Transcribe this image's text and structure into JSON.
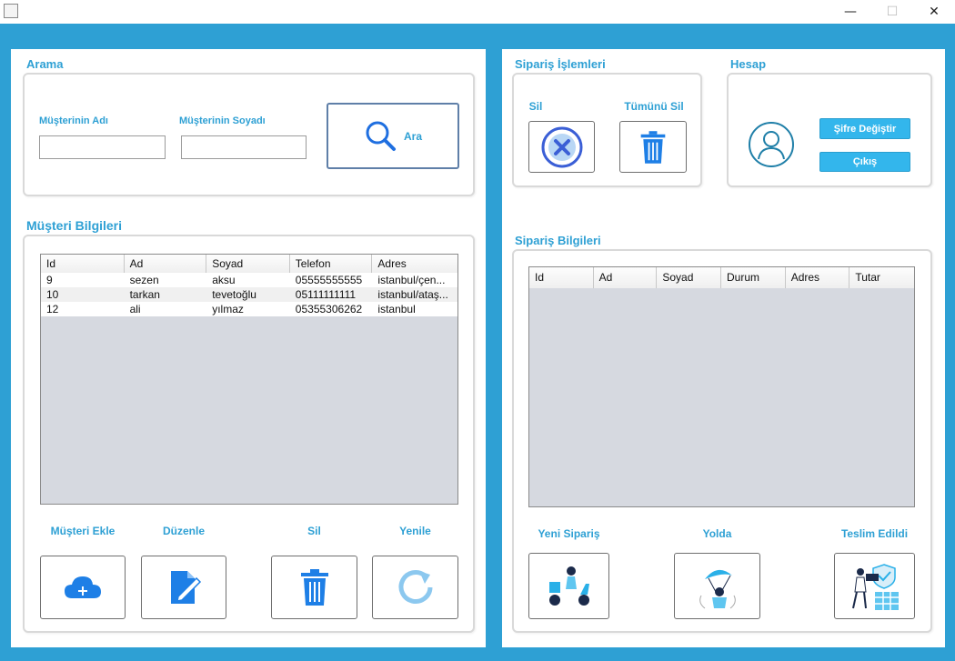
{
  "window": {
    "minimize": "—",
    "maximize": "☐",
    "close": "✕"
  },
  "search": {
    "title": "Arama",
    "first_name_label": "Müşterinin Adı",
    "first_name_value": "",
    "last_name_label": "Müşterinin Soyadı",
    "last_name_value": "",
    "search_button": "Ara"
  },
  "customers": {
    "title": "Müşteri Bilgileri",
    "columns": [
      "Id",
      "Ad",
      "Soyad",
      "Telefon",
      "Adres"
    ],
    "rows": [
      [
        "9",
        "sezen",
        "aksu",
        "05555555555",
        "istanbul/çen..."
      ],
      [
        "10",
        "tarkan",
        "tevetoğlu",
        "05111111111",
        "istanbul/ataş..."
      ],
      [
        "12",
        "ali",
        "yılmaz",
        "05355306262",
        "istanbul"
      ]
    ],
    "actions": {
      "add": "Müşteri Ekle",
      "edit": "Düzenle",
      "delete": "Sil",
      "refresh": "Yenile"
    }
  },
  "order_ops": {
    "title": "Sipariş İşlemleri",
    "delete": "Sil",
    "delete_all": "Tümünü Sil"
  },
  "account": {
    "title": "Hesap",
    "change_password": "Şifre Değiştir",
    "logout": "Çıkış"
  },
  "orders": {
    "title": "Sipariş Bilgileri",
    "columns": [
      "Id",
      "Ad",
      "Soyad",
      "Durum",
      "Adres",
      "Tutar"
    ],
    "rows": [],
    "actions": {
      "new_order": "Yeni Sipariş",
      "on_the_way": "Yolda",
      "delivered": "Teslim Edildi"
    }
  },
  "colors": {
    "accent": "#2ea0d4",
    "button_blue": "#33b6ec",
    "icon_blue": "#1e88e5",
    "table_bg": "#d6d9e0"
  }
}
